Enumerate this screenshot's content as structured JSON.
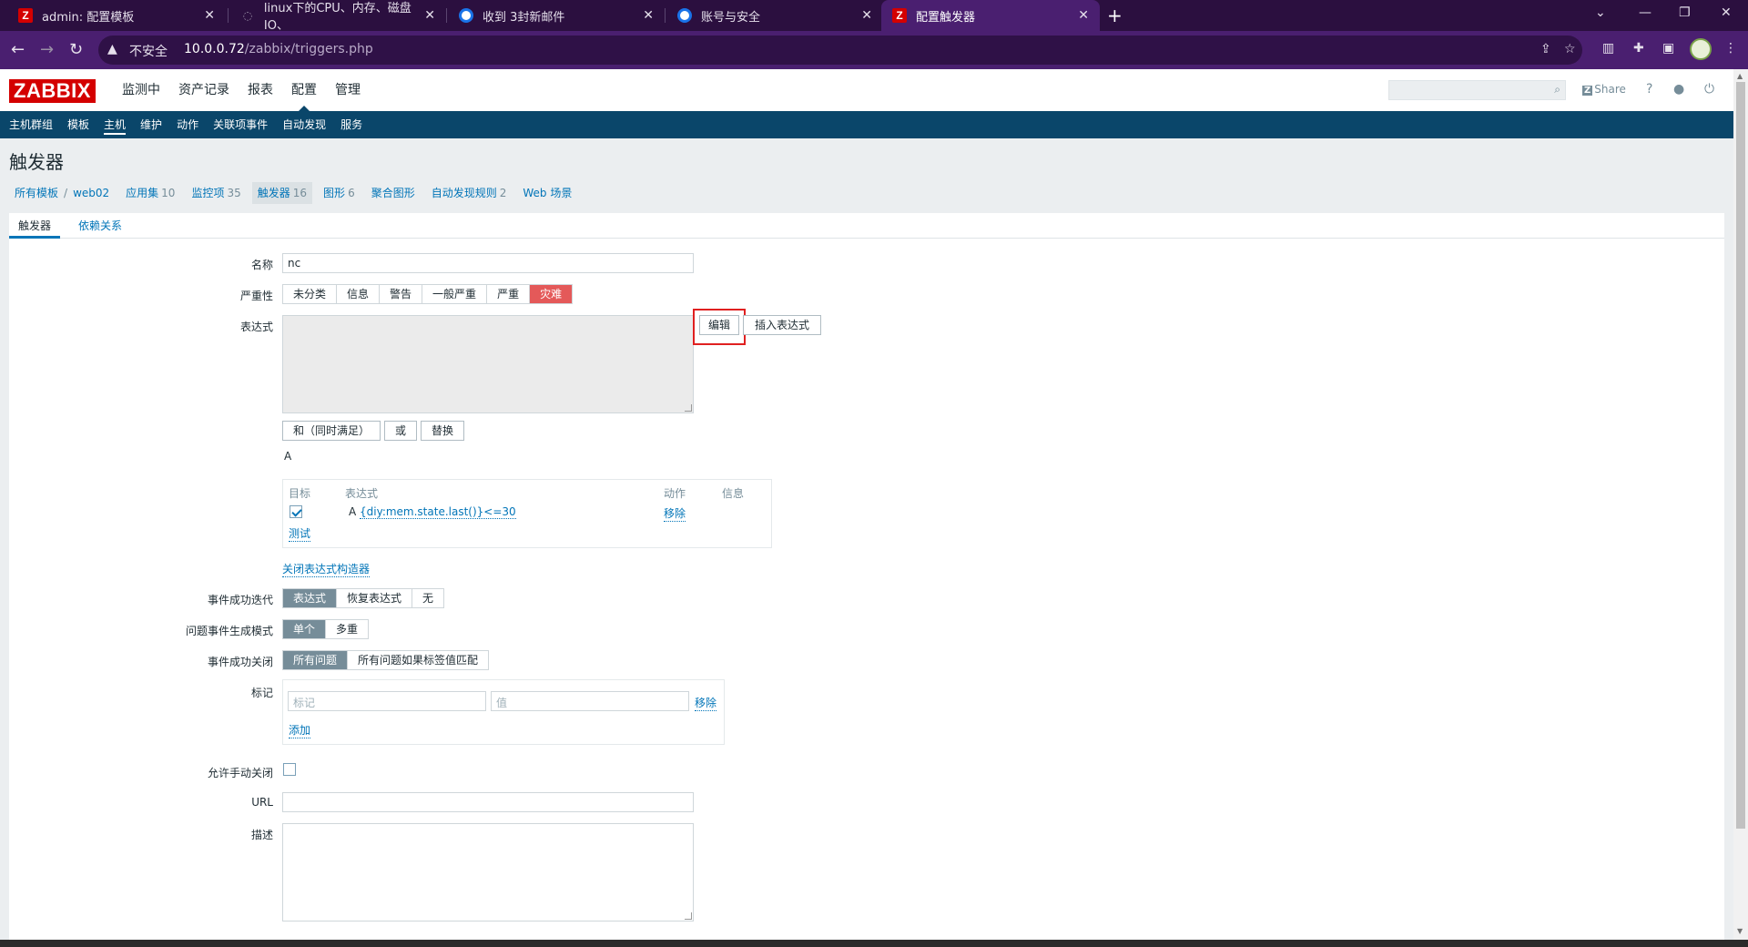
{
  "browser": {
    "tabs": [
      {
        "title": "admin: 配置模板",
        "favicon": "zabbix-z"
      },
      {
        "title": "linux下的CPU、内存、磁盘IO、",
        "favicon": "spinner"
      },
      {
        "title": "收到 3封新邮件",
        "favicon": "chrome-circle"
      },
      {
        "title": "账号与安全",
        "favicon": "chrome-circle"
      },
      {
        "title": "配置触发器",
        "favicon": "zabbix-z",
        "active": true
      }
    ],
    "omnibox": {
      "security": "不安全",
      "host": "10.0.0.72",
      "path": "/zabbix/triggers.php"
    }
  },
  "zabbix": {
    "logo": "ZABBIX",
    "main_menu": [
      "监测中",
      "资产记录",
      "报表",
      "配置",
      "管理"
    ],
    "main_menu_selected": "配置",
    "share": "Share",
    "share_badge": "Z",
    "sub_menu": [
      "主机群组",
      "模板",
      "主机",
      "维护",
      "动作",
      "关联项事件",
      "自动发现",
      "服务"
    ],
    "sub_menu_selected": "主机"
  },
  "page": {
    "title": "触发器",
    "breadcrumbs": {
      "all": "所有模板",
      "host": "web02",
      "apps": {
        "label": "应用集",
        "count": "10"
      },
      "items": {
        "label": "监控项",
        "count": "35"
      },
      "triggers": {
        "label": "触发器",
        "count": "16"
      },
      "graphs": {
        "label": "图形",
        "count": "6"
      },
      "screens": {
        "label": "聚合图形"
      },
      "discovery": {
        "label": "自动发现规则",
        "count": "2"
      },
      "web": {
        "label": "Web 场景"
      }
    },
    "form_tabs": [
      "触发器",
      "依赖关系"
    ]
  },
  "form": {
    "name_label": "名称",
    "name_value": "nc",
    "severity_label": "严重性",
    "severity_options": [
      "未分类",
      "信息",
      "警告",
      "一般严重",
      "严重",
      "灾难"
    ],
    "severity_selected": "灾难",
    "expression_label": "表达式",
    "edit_button": "编辑",
    "insert_expression_button": "插入表达式",
    "and_button": "和（同时满足）",
    "or_button": "或",
    "replace_button": "替换",
    "expression_preview": "A",
    "expr_table": {
      "headers": [
        "目标",
        "表达式",
        "动作",
        "信息"
      ],
      "row_label": "A",
      "row_expression": "{diy:mem.state.last()}<=30",
      "row_action": "移除",
      "test_link": "测试"
    },
    "close_builder_link": "关闭表达式构造器",
    "ok_event_generation_label": "事件成功迭代",
    "ok_event_generation_options": [
      "表达式",
      "恢复表达式",
      "无"
    ],
    "ok_event_generation_selected": "表达式",
    "problem_mode_label": "问题事件生成模式",
    "problem_mode_options": [
      "单个",
      "多重"
    ],
    "problem_mode_selected": "单个",
    "ok_close_label": "事件成功关闭",
    "ok_close_options": [
      "所有问题",
      "所有问题如果标签值匹配"
    ],
    "ok_close_selected": "所有问题",
    "tags_label": "标记",
    "tag_placeholder": "标记",
    "value_placeholder": "值",
    "tag_remove": "移除",
    "tag_add": "添加",
    "manual_close_label": "允许手动关闭",
    "url_label": "URL",
    "description_label": "描述"
  }
}
